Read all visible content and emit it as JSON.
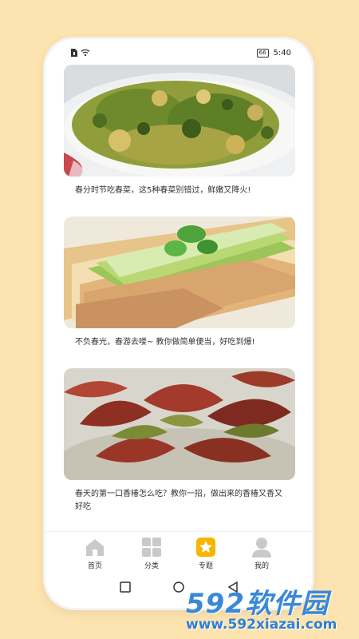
{
  "status_bar": {
    "left_icons": [
      "sim-card-icon",
      "wifi-icon"
    ],
    "battery": "66",
    "time": "5:40"
  },
  "feed": [
    {
      "caption": "春分时节吃春菜，这5种春菜别错过，鲜嫩又降火!",
      "image": "herb-omelette-photo"
    },
    {
      "caption": "不负春光，春游去喽~ 教你做简单便当，好吃到爆!",
      "image": "cucumber-sandwich-photo"
    },
    {
      "caption": "春天的第一口香椿怎么吃？教你一招，做出来的香椿又香又好吃",
      "image": "toona-sprouts-photo"
    }
  ],
  "tabbar": [
    {
      "label": "首页",
      "icon": "home-icon",
      "active": false
    },
    {
      "label": "分类",
      "icon": "grid-icon",
      "active": false
    },
    {
      "label": "专题",
      "icon": "star-icon",
      "active": true
    },
    {
      "label": "我的",
      "icon": "person-icon",
      "active": false
    }
  ],
  "colors": {
    "background": "#fde3b0",
    "accent": "#f7b500",
    "inactive_icon": "#c9c9c9",
    "watermark": "#3a88d8"
  },
  "watermark": {
    "brand": "592软件园",
    "url": "www.592xiazai.com"
  }
}
